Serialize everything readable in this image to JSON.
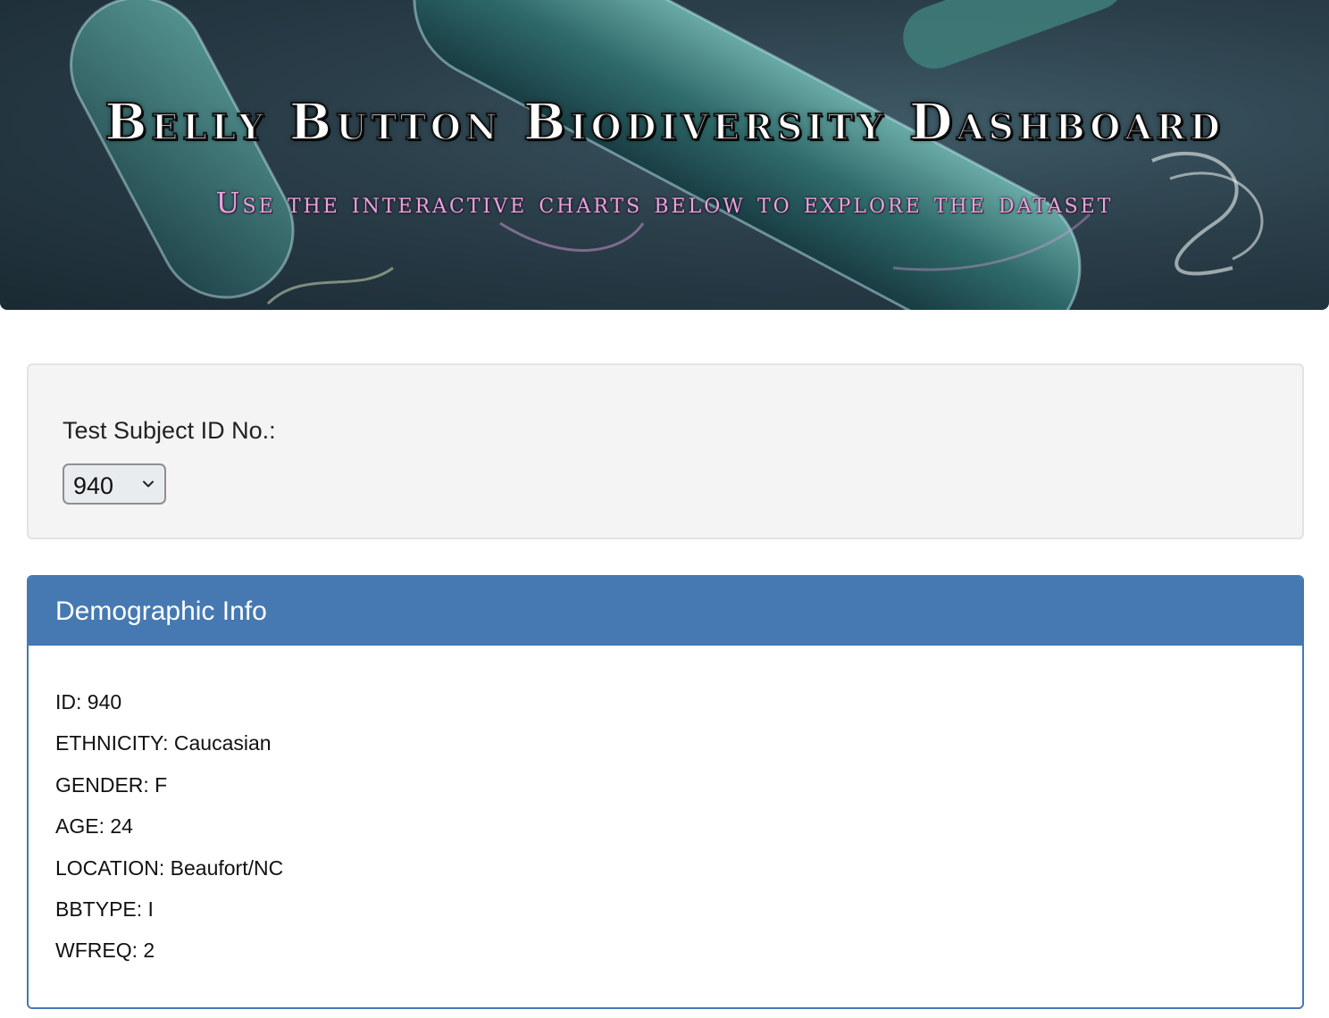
{
  "header": {
    "title": "Belly Button Biodiversity Dashboard",
    "subtitle": "Use the interactive charts below to explore the dataset"
  },
  "selector": {
    "label": "Test Subject ID No.:",
    "selected_value": "940"
  },
  "demographics": {
    "heading": "Demographic Info",
    "rows": [
      "ID: 940",
      "ETHNICITY: Caucasian",
      "GENDER: F",
      "AGE: 24",
      "LOCATION: Beaufort/NC",
      "BBTYPE: I",
      "WFREQ: 2"
    ]
  },
  "colors": {
    "panel_primary": "#4679b2",
    "well_background": "#f4f4f4",
    "subtitle_pink": "#e9a3e0"
  }
}
